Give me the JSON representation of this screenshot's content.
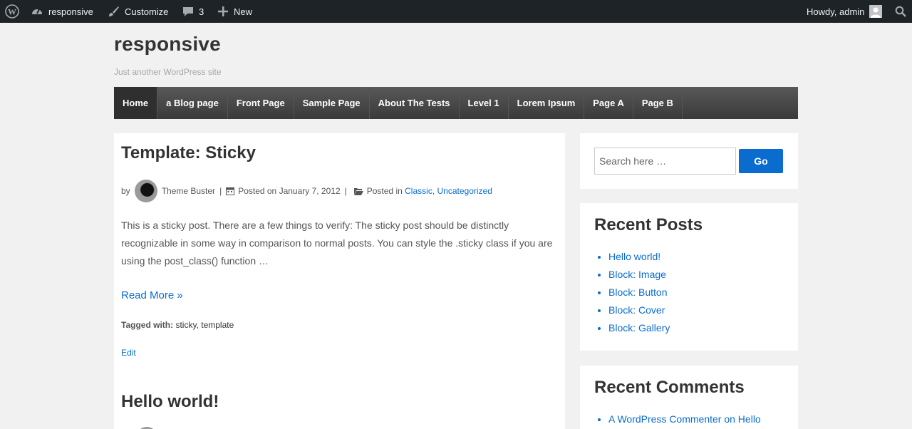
{
  "adminbar": {
    "site_name": "responsive",
    "customize": "Customize",
    "comments_count": "3",
    "new_label": "New",
    "howdy": "Howdy, admin"
  },
  "header": {
    "site_title": "responsive",
    "tagline": "Just another WordPress site"
  },
  "nav": {
    "items": [
      "Home",
      "a Blog page",
      "Front Page",
      "Sample Page",
      "About The Tests",
      "Level 1",
      "Lorem Ipsum",
      "Page A",
      "Page B"
    ],
    "active": "Home"
  },
  "posts": [
    {
      "title": "Template: Sticky",
      "by": "by",
      "author": "Theme Buster",
      "sep": "|",
      "posted_on": "Posted on January 7, 2012",
      "posted_in_label": "Posted in",
      "categories": [
        "Classic",
        "Uncategorized"
      ],
      "comma": ",",
      "excerpt": "This is a sticky post. There are a few things to verify: The sticky post should be distinctly recognizable in some way in comparison to normal posts. You can style the .sticky class if you are using the post_class() function …",
      "read_more": "Read More »",
      "tagged_label": "Tagged with:",
      "tags": [
        "sticky",
        "template"
      ],
      "edit": "Edit"
    },
    {
      "title": "Hello world!"
    }
  ],
  "sidebar": {
    "search_placeholder": "Search here …",
    "go_label": "Go",
    "recent_posts": {
      "title": "Recent Posts",
      "items": [
        "Hello world!",
        "Block: Image",
        "Block: Button",
        "Block: Cover",
        "Block: Gallery"
      ]
    },
    "recent_comments": {
      "title": "Recent Comments",
      "items": [
        "A WordPress Commenter on Hello"
      ]
    }
  },
  "colors": {
    "accent": "#0a6ccf",
    "adminbar": "#1d2327",
    "background": "#f1f1f1"
  }
}
